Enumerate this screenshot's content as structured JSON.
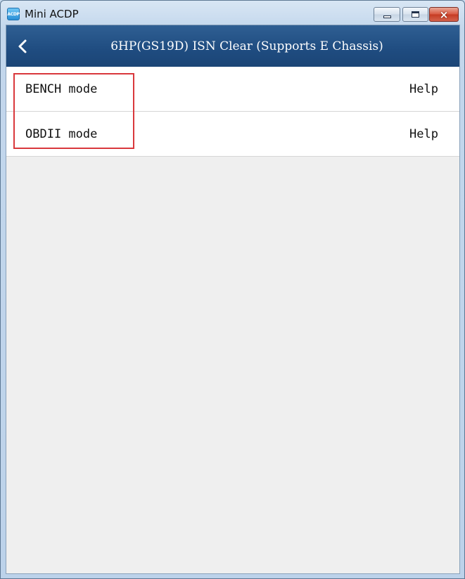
{
  "window": {
    "title": "Mini ACDP",
    "icon_text": "ACDP",
    "controls": {
      "minimize": "minimize-icon",
      "maximize": "maximize-icon",
      "close": "×"
    }
  },
  "header": {
    "title": "6HP(GS19D) ISN Clear (Supports E Chassis)",
    "back_icon": "chevron-left-icon"
  },
  "menu": {
    "items": [
      {
        "label": "BENCH mode",
        "help": "Help"
      },
      {
        "label": "OBDII mode",
        "help": "Help"
      }
    ]
  },
  "colors": {
    "header_bg": "#1f4c80",
    "highlight_border": "#d9383c",
    "content_bg": "#efefef"
  }
}
